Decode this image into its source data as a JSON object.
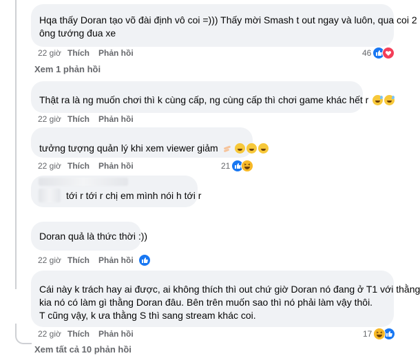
{
  "comments": [
    {
      "lines": [
        "Hqa thấy Doran tạo võ đài định vô coi =))) Thấy mời Smash t out ngay và luôn, qua coi 2",
        "ông tướng đua xe"
      ],
      "time": "22 giờ",
      "like": "Thích",
      "reply": "Phản hồi",
      "reaction_count": "46",
      "reactions": [
        "like-icon",
        "love-icon"
      ]
    },
    {
      "lines": [
        "Thật ra là ng muốn chơi thì k cùng cấp, ng cùng cấp thì chơi game khác hết r"
      ],
      "time": "22 giờ",
      "like": "Thích",
      "reply": "Phản hồi"
    },
    {
      "lines": [
        "tưởng tượng quản lý khi xem viewer giảm"
      ],
      "time": "22 giờ",
      "like": "Thích",
      "reply": "Phản hồi",
      "reaction_count": "21",
      "reactions": [
        "like-icon",
        "haha-icon"
      ]
    },
    {
      "lines": [
        "tới r tới r chị em mình nói h tới r"
      ],
      "time": "",
      "like": "",
      "reply": ""
    },
    {
      "lines": [
        "Doran quả là thức thời :))"
      ],
      "time": "22 giờ",
      "like": "Thích",
      "reply": "Phản hồi",
      "reactions": [
        "like-icon"
      ]
    },
    {
      "lines": [
        "Cái này k trách hay ai được, ai không thích thì out chứ giờ Doran nó đang ở T1 với thằng",
        "kia nó có làm gì thằng Doran đâu. Bên trên muốn sao thì nó phải làm vậy thôi.",
        "T cũng vậy, k ưa thằng S thì sang stream khác coi."
      ],
      "time": "22 giờ",
      "like": "Thích",
      "reply": "Phản hồi",
      "reaction_count": "17",
      "reactions": [
        "haha-icon",
        "like-icon"
      ]
    }
  ],
  "see_replies_1": "Xem 1 phản hồi",
  "see_all_replies": "Xem tất cả 10 phản hồi",
  "colors": {
    "bubble": "#f0f2f5",
    "like": "#1877f2",
    "love": "#f33e58",
    "haha": "#f7b928",
    "meta": "#65676b"
  }
}
